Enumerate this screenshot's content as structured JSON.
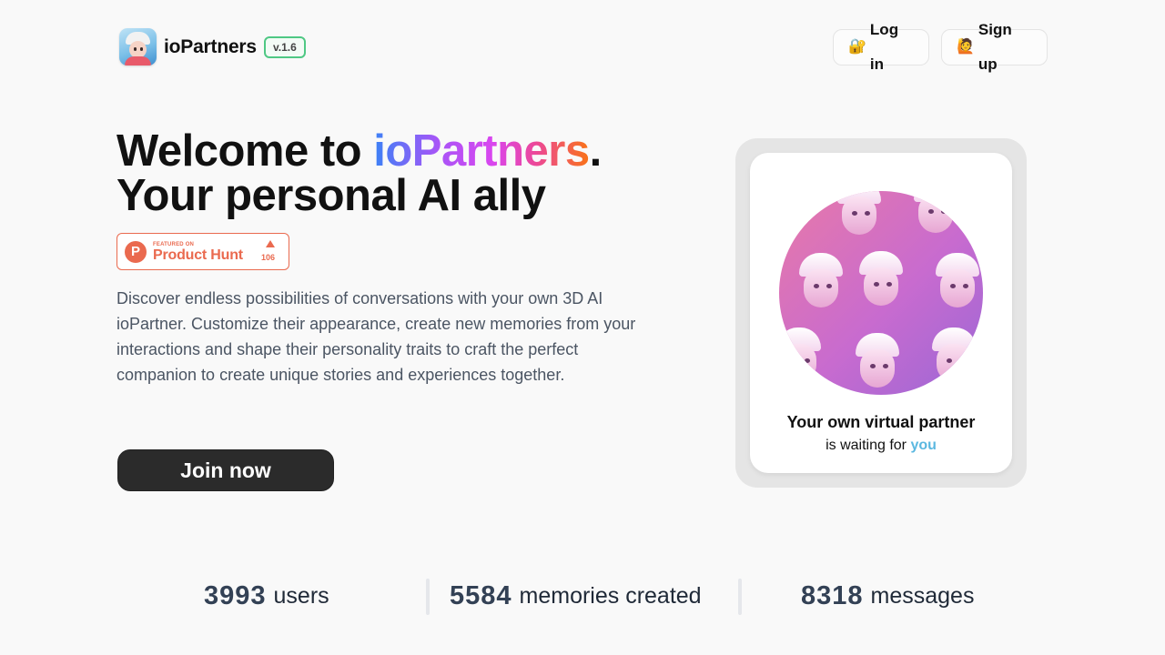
{
  "header": {
    "brand": "ioPartners",
    "version": "v.1.6",
    "login_emoji": "🔐",
    "login_label": "Log in",
    "signup_emoji": "🙋",
    "signup_label": "Sign up"
  },
  "hero": {
    "title_prefix": "Welcome to ",
    "title_brand": "ioPartners",
    "title_period": ".",
    "title_line2": "Your personal AI ally",
    "product_hunt": {
      "featured": "FEATURED ON",
      "name": "Product Hunt",
      "icon_letter": "P",
      "count": "106"
    },
    "description": "Discover endless possibilities of conversations with your own 3D AI ioPartner. Customize their appearance, create new memories from your interactions and shape their personality traits to craft the perfect companion to create unique stories and experiences together.",
    "cta_label": "Join now"
  },
  "card": {
    "caption_line1": "Your own virtual partner",
    "caption_line2_prefix": "is waiting for ",
    "caption_line2_highlight": "you"
  },
  "stats": [
    {
      "value": "3993",
      "label": "users"
    },
    {
      "value": "5584",
      "label": "memories created"
    },
    {
      "value": "8318",
      "label": "messages"
    }
  ],
  "colors": {
    "background": "#f9f9f9",
    "accent_green": "#4fc884",
    "product_hunt": "#ea6a4f",
    "cta": "#2b2b2b",
    "highlight_you": "#5bb8e0"
  }
}
